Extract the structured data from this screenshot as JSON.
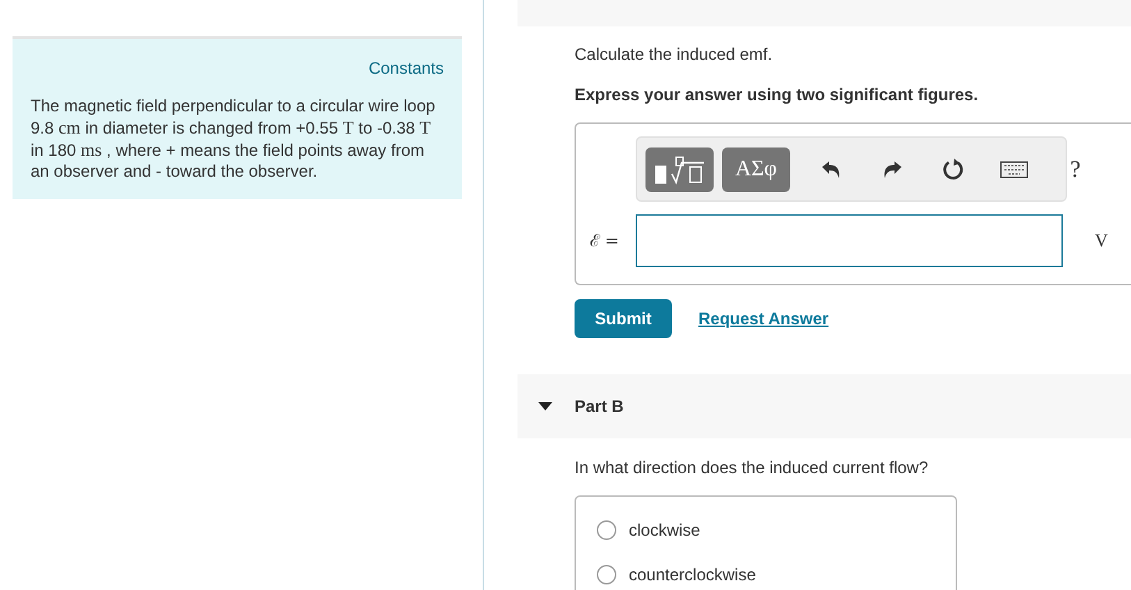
{
  "constants_link": "Constants",
  "description": [
    {
      "kind": "text",
      "text": "The magnetic field perpendicular to a circular wire loop 9.8 "
    },
    {
      "kind": "unit",
      "text": "cm"
    },
    {
      "kind": "text",
      "text": " in diameter is changed from +0.55 "
    },
    {
      "kind": "unit",
      "text": "T"
    },
    {
      "kind": "text",
      "text": " to -0.38 "
    },
    {
      "kind": "unit",
      "text": "T"
    },
    {
      "kind": "text",
      "text": " in 180 "
    },
    {
      "kind": "unit",
      "text": "ms"
    },
    {
      "kind": "text",
      "text": " , where + means the field points away from an observer and - toward the observer."
    }
  ],
  "part_a": {
    "prompt": "Calculate the induced emf.",
    "instruction": "Express your answer using two significant figures.",
    "toolbar": [
      {
        "kind": "templates"
      },
      {
        "kind": "text",
        "text": "ΑΣφ"
      },
      {
        "kind": "undo"
      },
      {
        "kind": "redo"
      },
      {
        "kind": "reset"
      },
      {
        "kind": "keyboard"
      },
      {
        "kind": "help",
        "text": "?"
      }
    ],
    "variable": "ℰ =",
    "unit": "V",
    "submit": "Submit",
    "request": "Request Answer"
  },
  "part_b": {
    "title": "Part B",
    "expanded": true,
    "prompt": "In what direction does the induced current flow?",
    "options": [
      {
        "label": "clockwise",
        "selected": false
      },
      {
        "label": "counterclockwise",
        "selected": false
      }
    ]
  }
}
